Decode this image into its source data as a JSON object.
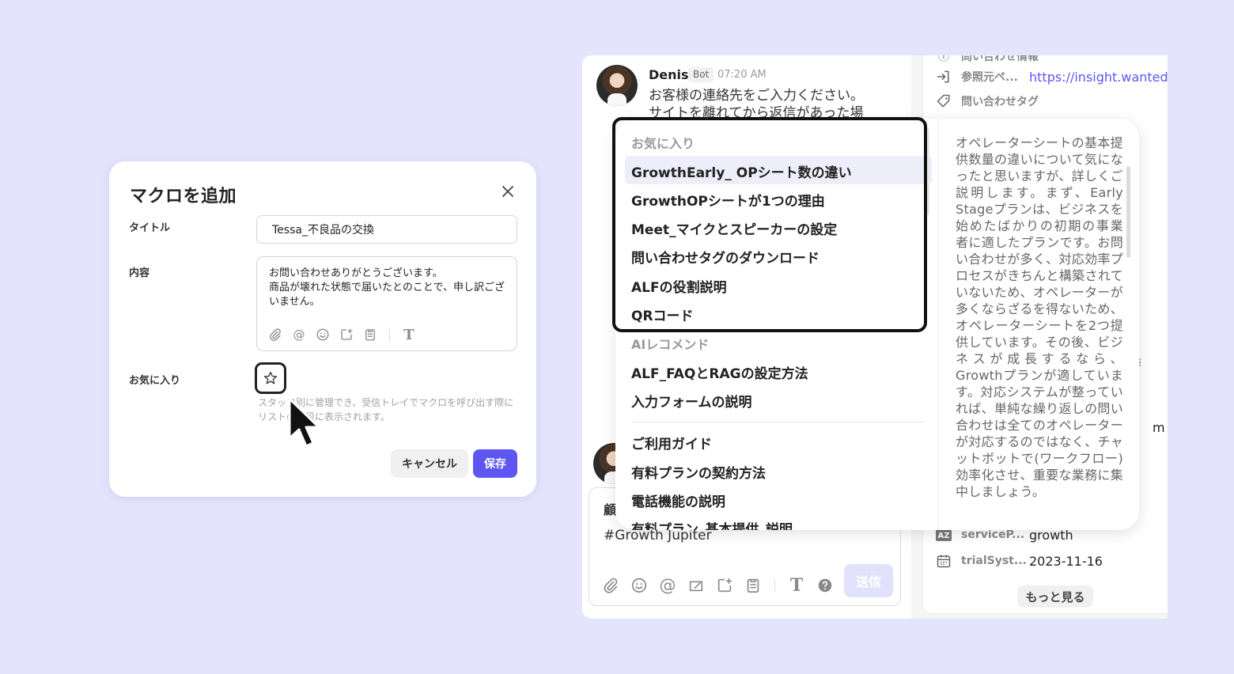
{
  "modal": {
    "title": "マクロを追加",
    "title_label": "タイトル",
    "title_value": "Tessa_不良品の交換",
    "content_label": "内容",
    "content_text": "お問い合わせありがとうございます。\n商品が壊れた状態で届いたとのことで、申し訳ございません。",
    "favorite_label": "お気に入り",
    "help_text": "スタッフ別に管理でき、受信トレイでマクロを呼び出す際にリストの上段に表示されます。",
    "cancel_label": "キャンセル",
    "save_label": "保存"
  },
  "chat": {
    "sender": "Denis",
    "badge": "Bot",
    "time": "07:20 AM",
    "message": "お客様の連絡先をご入力ください。\nサイトを離れてから返信があった場",
    "composer_partial": "顧",
    "composer_text": "#Growth Jupiter",
    "send_label": "送信"
  },
  "sidebar": {
    "info_header": "問い合わせ情報",
    "referrer_label": "参照元ペ...",
    "referrer_value": "https://insight.wanted",
    "tags_label": "問い合わせタグ",
    "service_label": "serviceP...",
    "service_value": "growth",
    "trial_label": "trialSyst...",
    "trial_value": "2023-11-16",
    "more_label": "もっと見る",
    "cut_char": "m"
  },
  "dropdown": {
    "favorites_header": "お気に入り",
    "favorites": [
      "GrowthEarly_ OPシート数の違い",
      "GrowthOPシートが1つの理由",
      "Meet_マイクとスピーカーの設定",
      "問い合わせタグのダウンロード",
      "ALFの役割説明",
      "QRコード"
    ],
    "ai_header": "AIレコメンド",
    "ai_items": [
      "ALF_FAQとRAGの設定方法",
      "入力フォームの説明"
    ],
    "other_items": [
      "ご利用ガイド",
      "有料プランの契約方法",
      "電話機能の説明",
      "有料プラン_基本提供_説明"
    ],
    "preview": "オペレーターシートの基本提供数量の違いについて気になったと思いますが、詳しくご説明します。まず、Early Stageプランは、ビジネスを始めたばかりの初期の事業者に適したプランです。お問い合わせが多く、対応効率プロセスがきちんと構築されていないため、オペレーターが多くならざるを得ないため、オペレーターシートを2つ提供しています。その後、ビジネスが成長するなら、Growthプランが適しています。対応システムが整っていれば、単純な繰り返しの問い合わせは全てのオペレーターが対応するのではなく、チャットボットで(ワークフロー)効率化させ、重要な業務に集中しましょう。"
  },
  "colors": {
    "background": "#e4e4fd",
    "accent": "#5e56f0",
    "highlight": "#eeeefb"
  }
}
